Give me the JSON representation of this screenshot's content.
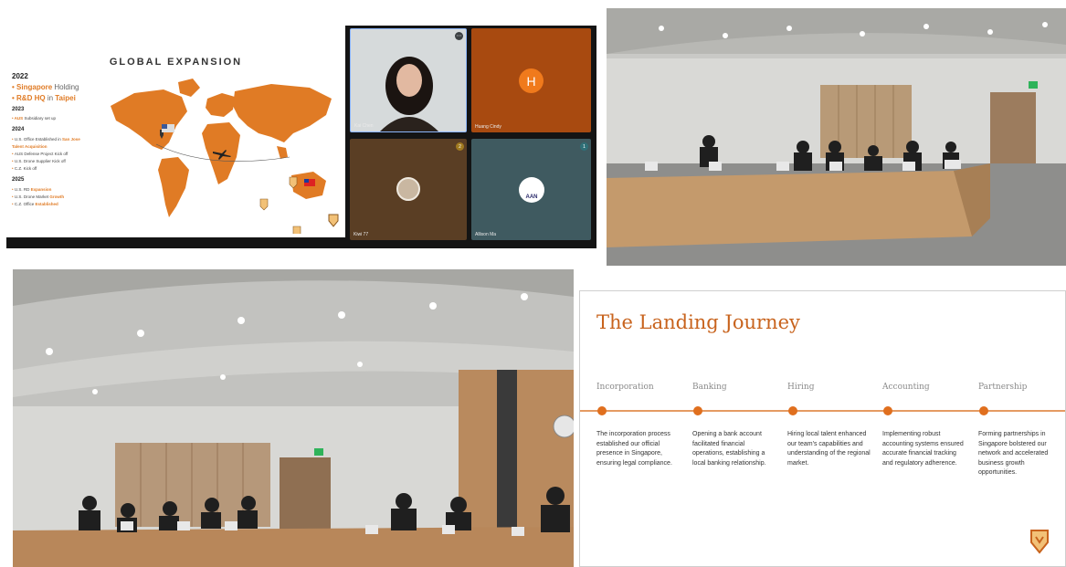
{
  "call": {
    "slide": {
      "title": "GLOBAL EXPANSION",
      "lines": [
        {
          "text": "2022",
          "kind": "yr"
        },
        {
          "bullet": "• ",
          "hl": "Singapore",
          "rest": " Holding",
          "kind": "big"
        },
        {
          "bullet": "• ",
          "hl": "R&D HQ",
          "mid": " in ",
          "hl2": "Taipei",
          "kind": "big"
        },
        {
          "text": "2023",
          "kind": "yr"
        },
        {
          "bullet": "• ",
          "hl": "AUS",
          "rest": " Subsidiary set up",
          "kind": "sm"
        },
        {
          "text": "2024",
          "kind": "yr"
        },
        {
          "bullet": "• ",
          "rest": "U.S. Office Established in ",
          "hl": "San Jose",
          "kind": "sm"
        },
        {
          "indent": "  ",
          "hl": "Talent Acquisition",
          "kind": "sm"
        },
        {
          "bullet": "• ",
          "rest": "AUS Defense Project Kick off",
          "kind": "sm"
        },
        {
          "bullet": "• ",
          "rest": "U.S. Drone Supplier Kick off",
          "kind": "sm"
        },
        {
          "bullet": "• ",
          "rest": "C.Z. Kick off",
          "kind": "sm"
        },
        {
          "text": "2025",
          "kind": "yr"
        },
        {
          "bullet": "• ",
          "rest": "U.S. RD ",
          "hl": "Expansion",
          "kind": "sm"
        },
        {
          "bullet": "• ",
          "rest": "U.S. Drone Market ",
          "hl": "Growth",
          "kind": "sm"
        },
        {
          "bullet": "• ",
          "rest": "C.Z. Office ",
          "hl": "Established",
          "kind": "sm"
        }
      ]
    },
    "tiles": [
      {
        "name": "Kai Chen"
      },
      {
        "name": "Huang Cindy",
        "initial": "H"
      },
      {
        "name": "Kiwi 77",
        "badge": "2"
      },
      {
        "name": "Allison Ma",
        "badge": "1",
        "avatar_text": "AAN"
      }
    ]
  },
  "journey": {
    "title": "The Landing Journey",
    "steps": [
      {
        "name": "Incorporation",
        "desc": "The incorporation process established our official presence in Singapore, ensuring legal compliance."
      },
      {
        "name": "Banking",
        "desc": "Opening a bank account facilitated financial operations, establishing a local banking relationship."
      },
      {
        "name": "Hiring",
        "desc": "Hiring local talent enhanced our team's capabilities and understanding of the regional market."
      },
      {
        "name": "Accounting",
        "desc": "Implementing robust accounting systems ensured accurate financial tracking and regulatory adherence."
      },
      {
        "name": "Partnership",
        "desc": "Forming partnerships in Singapore bolstered our network and accelerated business growth opportunities."
      }
    ]
  },
  "colors": {
    "accent": "#e07b25",
    "journey_accent": "#c8631d",
    "call_bg": "#141414"
  },
  "icons": [
    "shield-logo-icon",
    "airplane-icon",
    "flag-icon",
    "map-pin-icon",
    "more-options-icon"
  ]
}
